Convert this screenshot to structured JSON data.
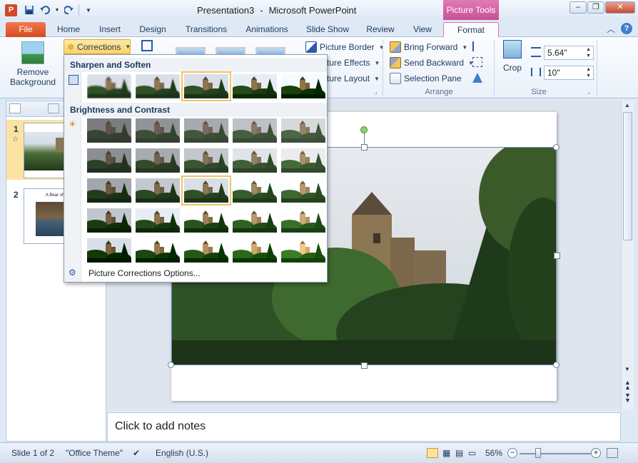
{
  "window": {
    "doc_name": "Presentation3",
    "separator": "-",
    "app_name": "Microsoft PowerPoint",
    "context_tab_header": "Picture Tools"
  },
  "tabs": [
    "File",
    "Home",
    "Insert",
    "Design",
    "Transitions",
    "Animations",
    "Slide Show",
    "Review",
    "View",
    "Format"
  ],
  "ribbon": {
    "remove_background_label_1": "Remove",
    "remove_background_label_2": "Background",
    "corrections_label": "Corrections",
    "picture_border": "Picture Border",
    "picture_effects": "cture Effects",
    "picture_layout": "cture Layout",
    "bring_forward": "Bring Forward",
    "send_backward": "Send Backward",
    "selection_pane": "Selection Pane",
    "arrange_group": "Arrange",
    "crop_label": "Crop",
    "height_value": "5.64\"",
    "width_value": "10\"",
    "size_group": "Size"
  },
  "corrections_gallery": {
    "sharpen_header": "Sharpen and Soften",
    "brightness_header": "Brightness and Contrast",
    "options_label": "Picture Corrections Options...",
    "sharpen_row": [
      0,
      1,
      2,
      3,
      4
    ],
    "brightness_grid": [
      [
        0.55,
        0.7,
        0.85,
        1.0,
        1.15
      ],
      [
        0.65,
        0.8,
        0.95,
        1.1,
        1.25
      ],
      [
        0.75,
        0.9,
        1.0,
        1.15,
        1.3
      ],
      [
        0.85,
        1.0,
        1.1,
        1.25,
        1.4
      ],
      [
        0.9,
        1.05,
        1.2,
        1.35,
        1.55
      ]
    ],
    "selected_sharpen_index": 2,
    "selected_brightness": [
      2,
      2
    ]
  },
  "slides_pane": {
    "slides": [
      {
        "number": "1",
        "selected": true
      },
      {
        "number": "2",
        "selected": false,
        "title_snippet": "A Bear of a"
      }
    ]
  },
  "notes_placeholder": "Click to add notes",
  "status": {
    "slide_info": "Slide 1 of 2",
    "theme": "\"Office Theme\"",
    "language": "English (U.S.)",
    "zoom": "56%"
  }
}
